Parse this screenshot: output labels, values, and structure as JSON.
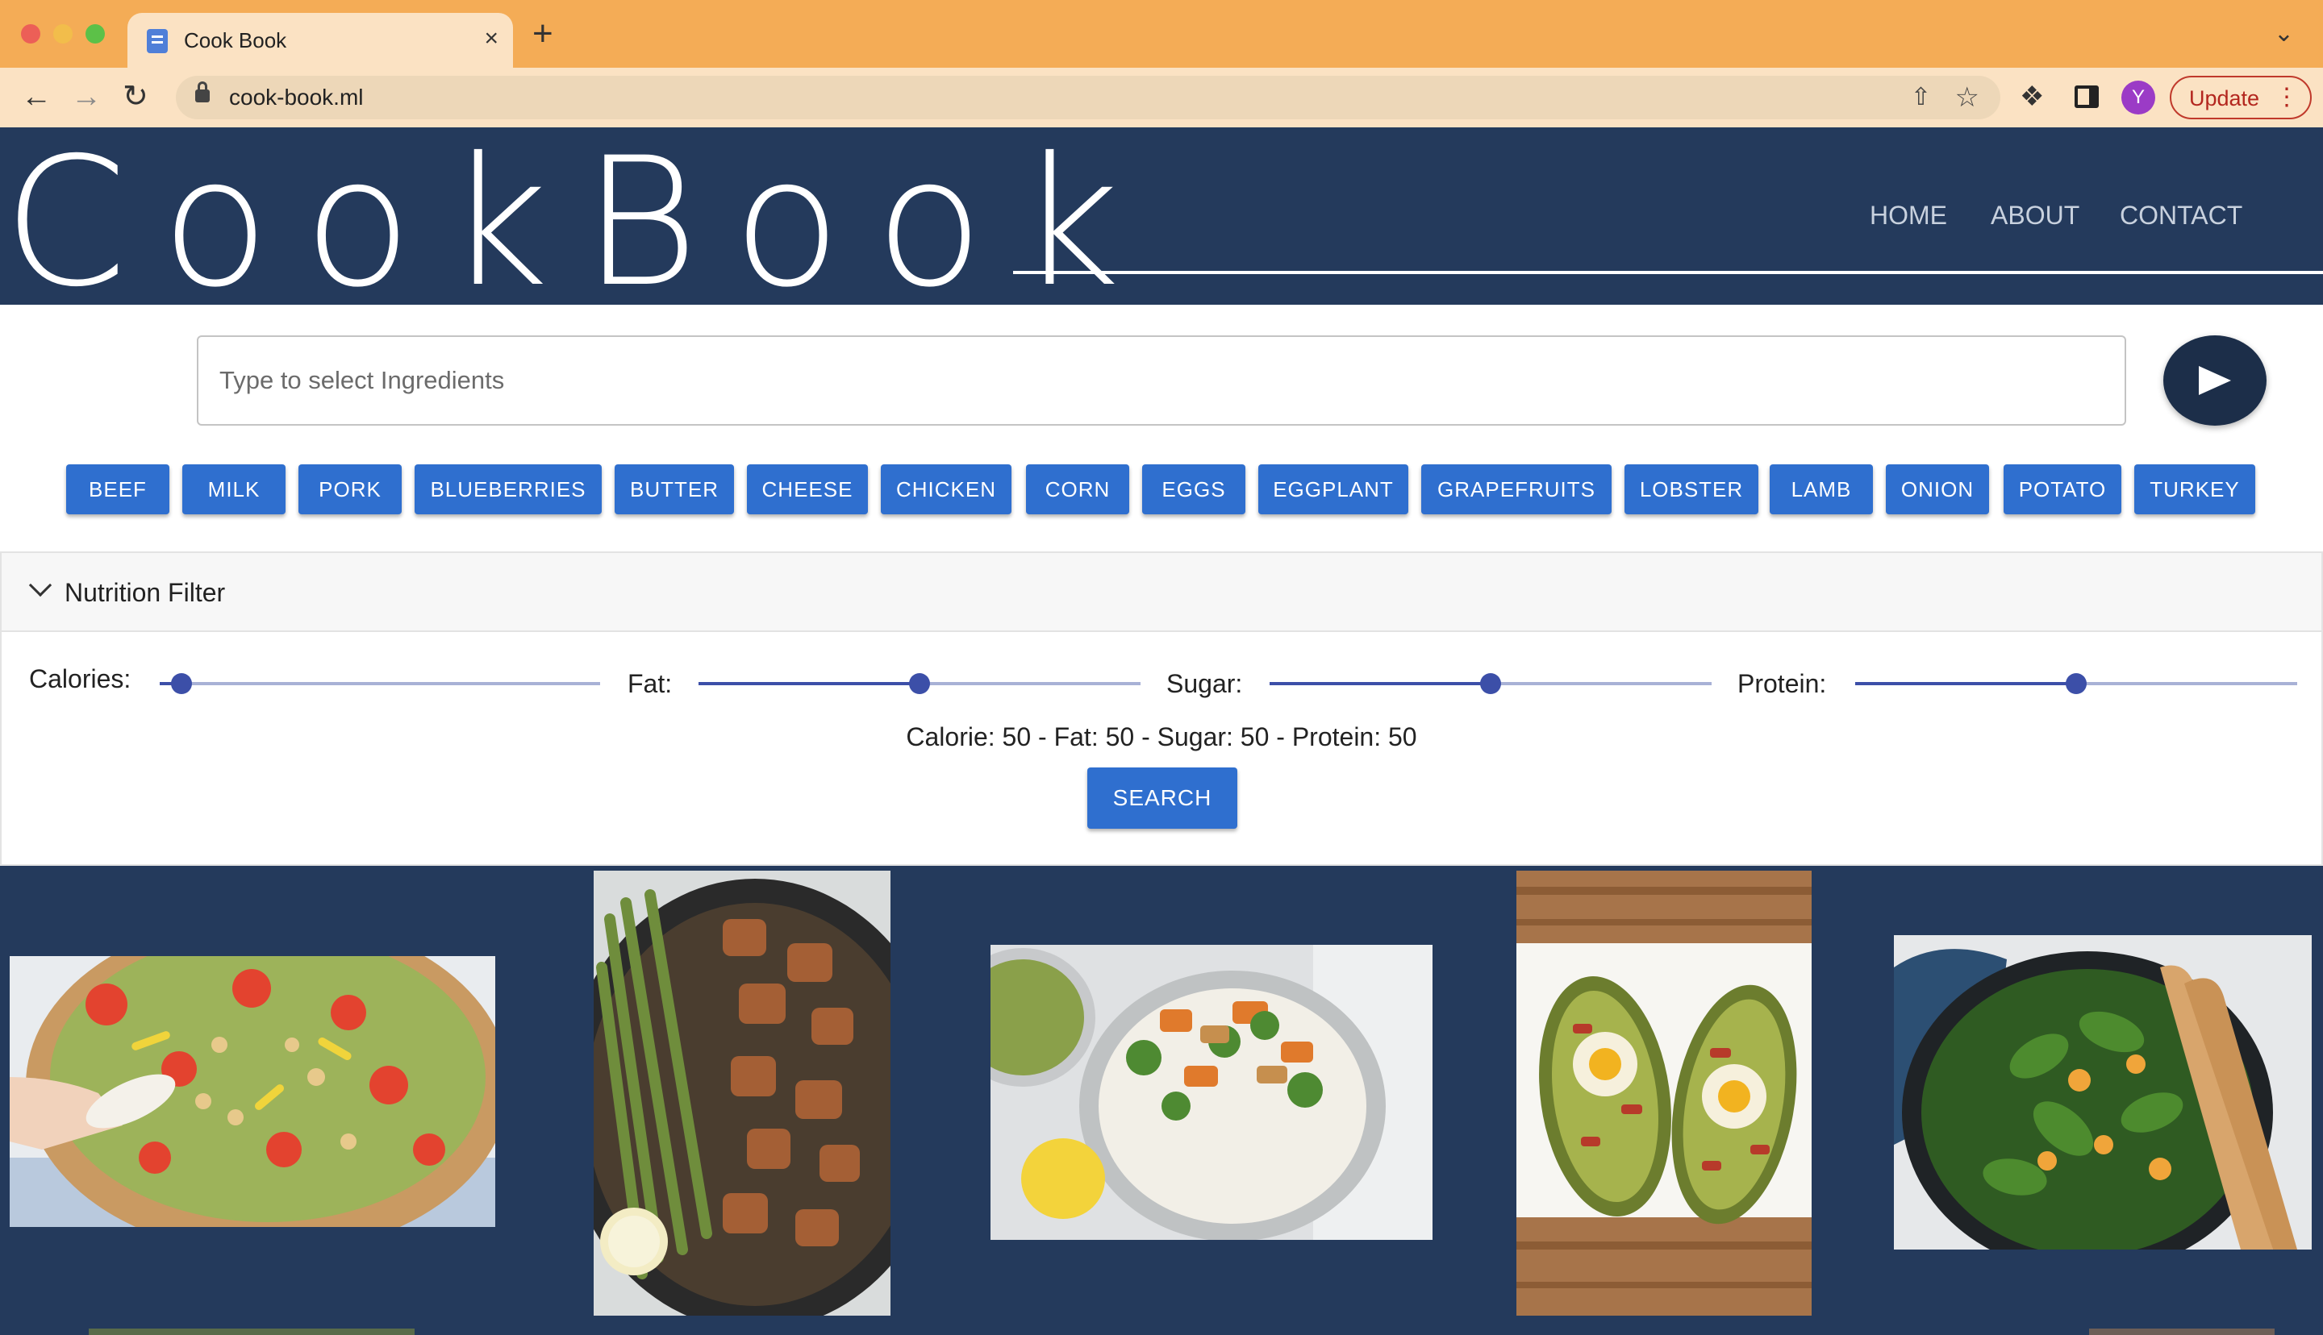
{
  "browser": {
    "tab_title": "Cook Book",
    "tab_close": "×",
    "new_tab": "+",
    "tab_menu": "⌄",
    "url": "cook-book.ml",
    "profile_initial": "Y",
    "update_label": "Update",
    "update_menu": "⋮"
  },
  "header": {
    "logo": "CookBook",
    "nav": {
      "home": "HOME",
      "about": "ABOUT",
      "contact": "CONTACT"
    }
  },
  "search": {
    "placeholder": "Type to select Ingredients",
    "value": ""
  },
  "ingredients": [
    "BEEF",
    "MILK",
    "PORK",
    "BLUEBERRIES",
    "BUTTER",
    "CHEESE",
    "CHICKEN",
    "CORN",
    "EGGS",
    "EGGPLANT",
    "GRAPEFRUITS",
    "LOBSTER",
    "LAMB",
    "ONION",
    "POTATO",
    "TURKEY"
  ],
  "nutrition_filter": {
    "title": "Nutrition Filter",
    "sliders": [
      {
        "label": "Calories:",
        "value_fraction": 0.05
      },
      {
        "label": "Fat:",
        "value_fraction": 0.5
      },
      {
        "label": "Sugar:",
        "value_fraction": 0.5
      },
      {
        "label": "Protein:",
        "value_fraction": 0.5
      }
    ],
    "summary": "Calorie: 50 - Fat: 50 - Sugar: 50 - Protein: 50",
    "search_label": "SEARCH"
  },
  "results": {
    "images": [
      "chickpea-salad-photo",
      "chicken-asparagus-skillet-photo",
      "chicken-veggie-rice-bowl-photo",
      "bacon-egg-avocado-photo",
      "spinach-salad-photo"
    ]
  },
  "colors": {
    "tab_bar": "#f4ac56",
    "header_bg": "#243a5c",
    "button_blue": "#2f6fcf",
    "slider_blue": "#3c4fa8"
  }
}
